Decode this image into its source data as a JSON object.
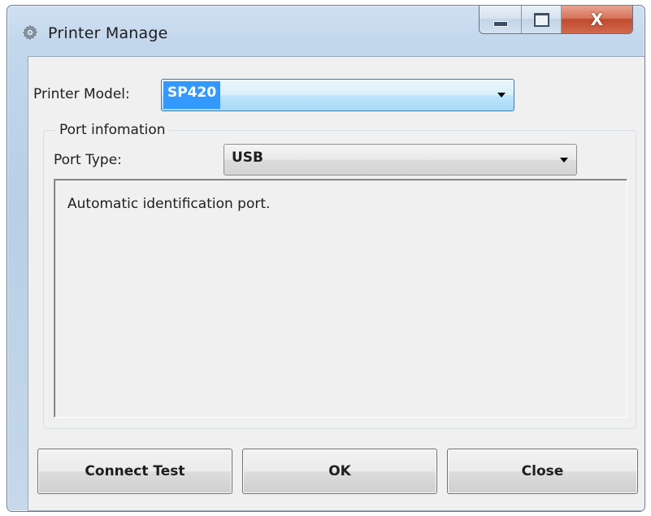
{
  "window": {
    "title": "Printer Manage",
    "icon": "gear-icon",
    "caption_buttons": {
      "minimize": "minimize-icon",
      "maximize": "maximize-icon",
      "close_glyph": "X"
    }
  },
  "form": {
    "printer_model_label": "Printer Model:",
    "printer_model_value": "SP420",
    "port_group_title": "Port infomation",
    "port_type_label": "Port Type:",
    "port_type_value": "USB",
    "port_info_text": "Automatic identification port."
  },
  "buttons": {
    "connect_test": "Connect Test",
    "ok": "OK",
    "close": "Close"
  },
  "colors": {
    "selection": "#3399ff",
    "close_button": "#c14a2f",
    "window_frame": "#b9cfe6",
    "client_bg": "#f0f0f0"
  }
}
